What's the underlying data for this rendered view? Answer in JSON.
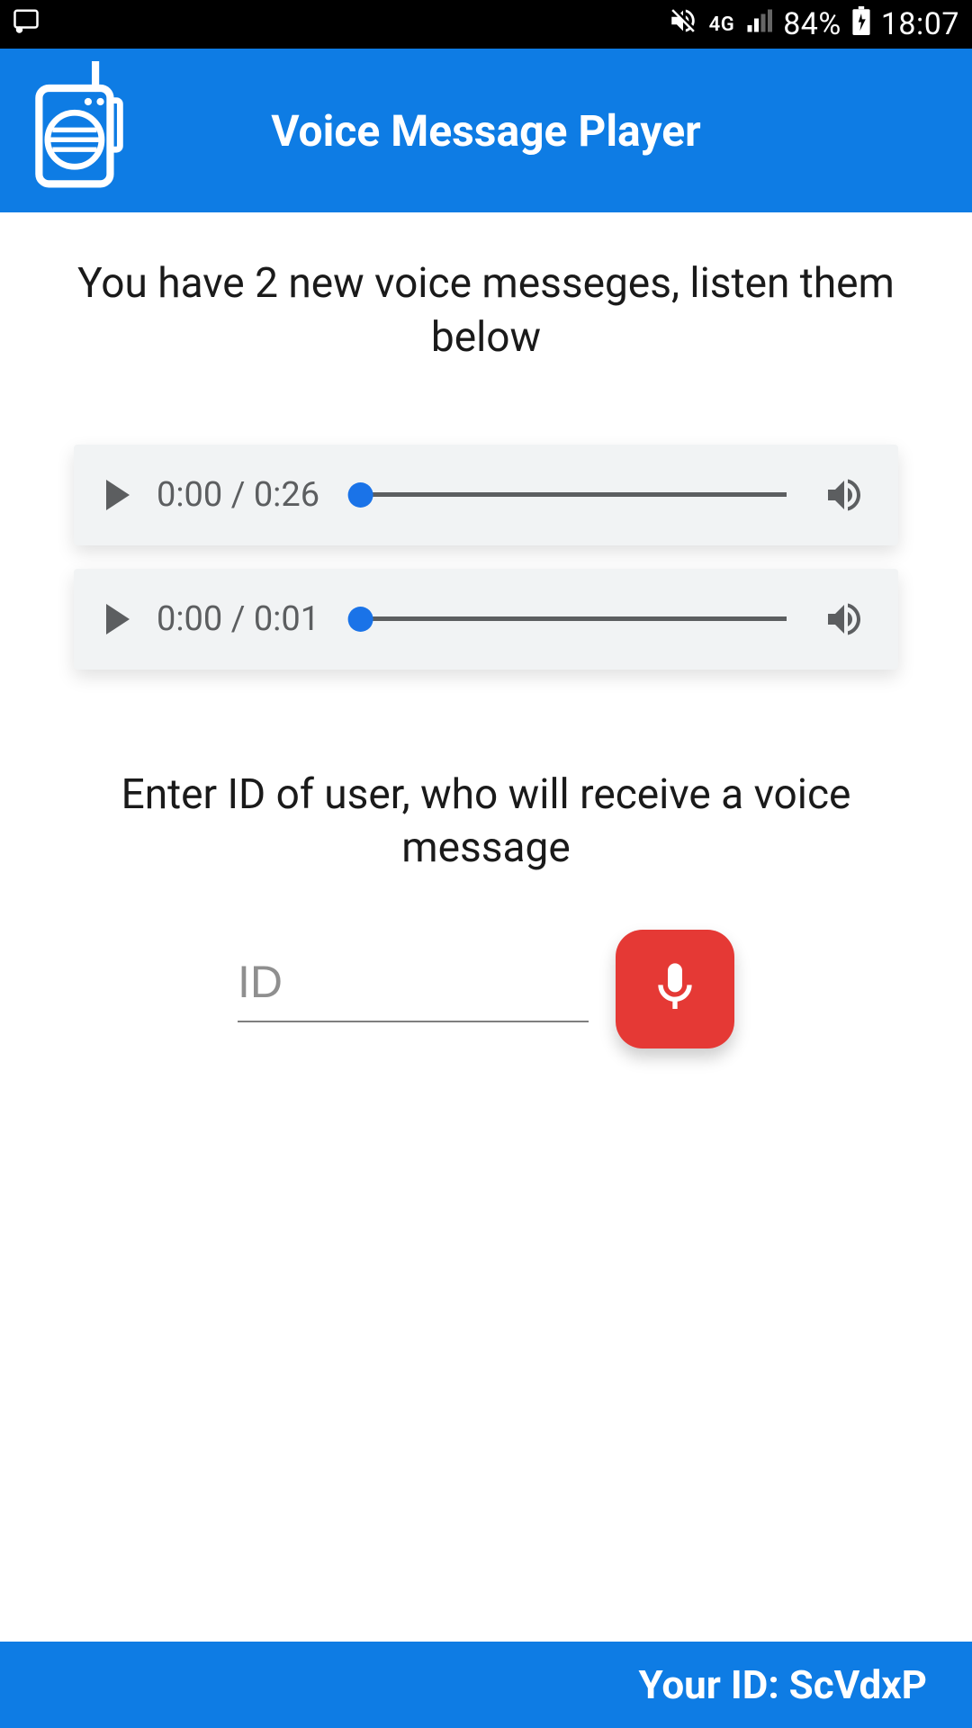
{
  "status": {
    "network": "4G",
    "battery": "84%",
    "time": "18:07"
  },
  "header": {
    "title": "Voice Message Player"
  },
  "main": {
    "new_messages_text": "You have 2 new voice messeges, listen them below",
    "players": [
      {
        "current": "0:00",
        "total": "0:26"
      },
      {
        "current": "0:00",
        "total": "0:01"
      }
    ],
    "enter_id_text": "Enter ID of user, who will receive a voice message",
    "id_placeholder": "ID"
  },
  "footer": {
    "your_id_label": "Your ID: ",
    "your_id_value": "ScVdxP"
  },
  "colors": {
    "brand": "#0e7ce4",
    "record": "#e53935",
    "thumb": "#1a73e8"
  }
}
